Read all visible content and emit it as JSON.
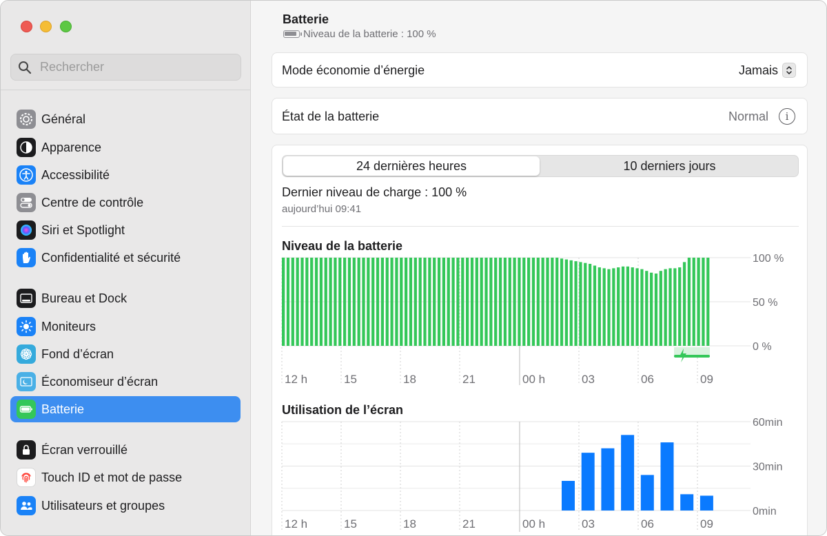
{
  "search": {
    "placeholder": "Rechercher"
  },
  "sidebar": {
    "items": [
      {
        "label": "Général",
        "icon": "gear-icon"
      },
      {
        "label": "Apparence",
        "icon": "appearance-icon"
      },
      {
        "label": "Accessibilité",
        "icon": "accessibility-icon"
      },
      {
        "label": "Centre de contrôle",
        "icon": "control-center-icon"
      },
      {
        "label": "Siri et Spotlight",
        "icon": "siri-icon"
      },
      {
        "label": "Confidentialité et sécurité",
        "icon": "hand-icon"
      },
      {
        "label": "Bureau et Dock",
        "icon": "dock-icon"
      },
      {
        "label": "Moniteurs",
        "icon": "sun-icon"
      },
      {
        "label": "Fond d’écran",
        "icon": "flower-icon"
      },
      {
        "label": "Économiseur d’écran",
        "icon": "screensaver-icon"
      },
      {
        "label": "Batterie",
        "icon": "battery-icon",
        "selected": true
      },
      {
        "label": "Écran verrouillé",
        "icon": "lock-icon"
      },
      {
        "label": "Touch ID et mot de passe",
        "icon": "fingerprint-icon"
      },
      {
        "label": "Utilisateurs et groupes",
        "icon": "users-icon"
      }
    ]
  },
  "header": {
    "title": "Batterie",
    "subtitle": "Niveau de la batterie : 100 %"
  },
  "energy_mode": {
    "label": "Mode économie d’énergie",
    "value": "Jamais"
  },
  "battery_health": {
    "label": "État de la batterie",
    "value": "Normal"
  },
  "usage": {
    "tabs": [
      "24 dernières heures",
      "10 derniers jours"
    ],
    "selected_tab": 0,
    "last_charge_label": "Dernier niveau de charge : 100 %",
    "last_charge_time": "aujourd’hui 09:41"
  },
  "colors": {
    "accent": "#3d8ef0",
    "battery_green": "#34c759",
    "usage_blue": "#0a7aff"
  },
  "chart_data": [
    {
      "type": "bar",
      "title": "Niveau de la batterie",
      "x_tick_labels": [
        "12 h",
        "15",
        "18",
        "21",
        "00 h",
        "03",
        "06",
        "09"
      ],
      "y_tick_labels": [
        "100 %",
        "50 %",
        "0 %"
      ],
      "ylim": [
        0,
        100
      ],
      "grid": true,
      "values": [
        100,
        100,
        100,
        100,
        100,
        100,
        100,
        100,
        100,
        100,
        100,
        100,
        100,
        100,
        100,
        100,
        100,
        100,
        100,
        100,
        100,
        100,
        100,
        100,
        100,
        100,
        100,
        100,
        100,
        100,
        100,
        100,
        100,
        100,
        100,
        100,
        100,
        100,
        100,
        100,
        100,
        100,
        100,
        100,
        100,
        100,
        100,
        100,
        100,
        100,
        100,
        100,
        100,
        100,
        100,
        100,
        100,
        100,
        100,
        99,
        98,
        97,
        96,
        95,
        94,
        93,
        91,
        89,
        88,
        87,
        88,
        89,
        90,
        90,
        89,
        88,
        87,
        85,
        83,
        82,
        85,
        87,
        88,
        88,
        89,
        95,
        100,
        100,
        100,
        100,
        100
      ],
      "charging_markers": [
        "08",
        "09"
      ]
    },
    {
      "type": "bar",
      "title": "Utilisation de l’écran",
      "x_tick_labels": [
        "12 h",
        "15",
        "18",
        "21",
        "00 h",
        "03",
        "06",
        "09"
      ],
      "y_tick_labels": [
        "60min",
        "30min",
        "0min"
      ],
      "ylim": [
        0,
        60
      ],
      "grid": true,
      "categories": [
        "02",
        "03",
        "04",
        "05",
        "06",
        "07",
        "08",
        "09"
      ],
      "values": [
        20,
        39,
        42,
        51,
        24,
        46,
        11,
        10
      ]
    }
  ]
}
